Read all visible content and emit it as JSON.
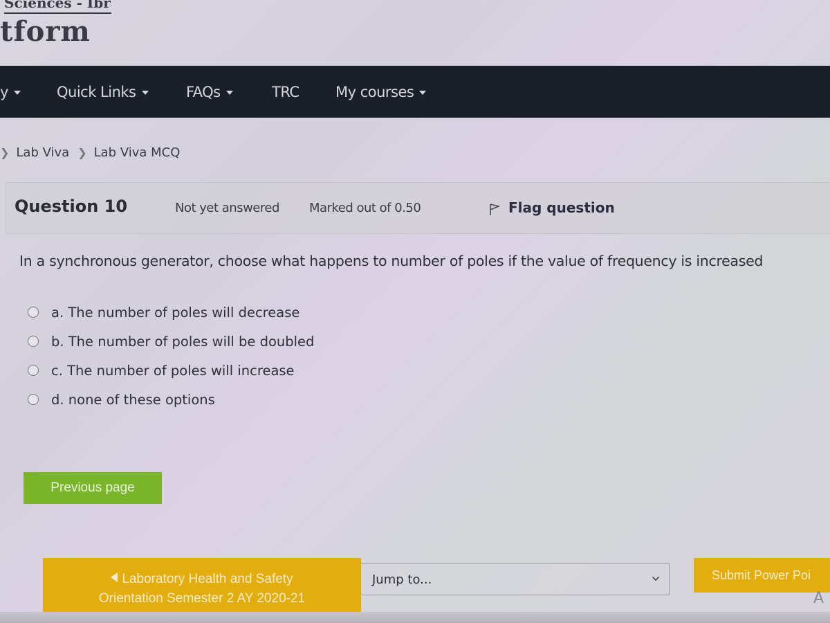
{
  "header": {
    "subtitle": "Sciences - Ibra",
    "title": "tform"
  },
  "nav": {
    "items": [
      {
        "label": "y",
        "has_dropdown": true
      },
      {
        "label": "Quick Links",
        "has_dropdown": true
      },
      {
        "label": "FAQs",
        "has_dropdown": true
      },
      {
        "label": "TRC",
        "has_dropdown": false
      },
      {
        "label": "My courses",
        "has_dropdown": true
      }
    ]
  },
  "breadcrumb": {
    "items": [
      "Lab Viva",
      "Lab Viva MCQ"
    ]
  },
  "question": {
    "number_label": "Question 10",
    "state": "Not yet answered",
    "grade": "Marked out of 0.50",
    "flag_label": "Flag question",
    "text": "In a synchronous generator, choose what happens to number of poles if the value of frequency is increased",
    "answers": [
      {
        "label": "a. The number of poles will decrease",
        "selected": false
      },
      {
        "label": "b. The number of poles will be doubled",
        "selected": false
      },
      {
        "label": "c. The number of poles will increase",
        "selected": false
      },
      {
        "label": "d. none of these options",
        "selected": false
      }
    ]
  },
  "buttons": {
    "previous_page": "Previous page",
    "previous_activity_line1": "Laboratory Health and Safety",
    "previous_activity_line2": "Orientation Semester 2 AY 2020-21",
    "next_activity": "Submit Power Poi"
  },
  "jump": {
    "placeholder": "Jump to..."
  },
  "trailing_text": "A",
  "colors": {
    "navbar": "#1b1f27",
    "primary_green": "#7ab52a",
    "activity_yellow": "#e3ad0e"
  }
}
